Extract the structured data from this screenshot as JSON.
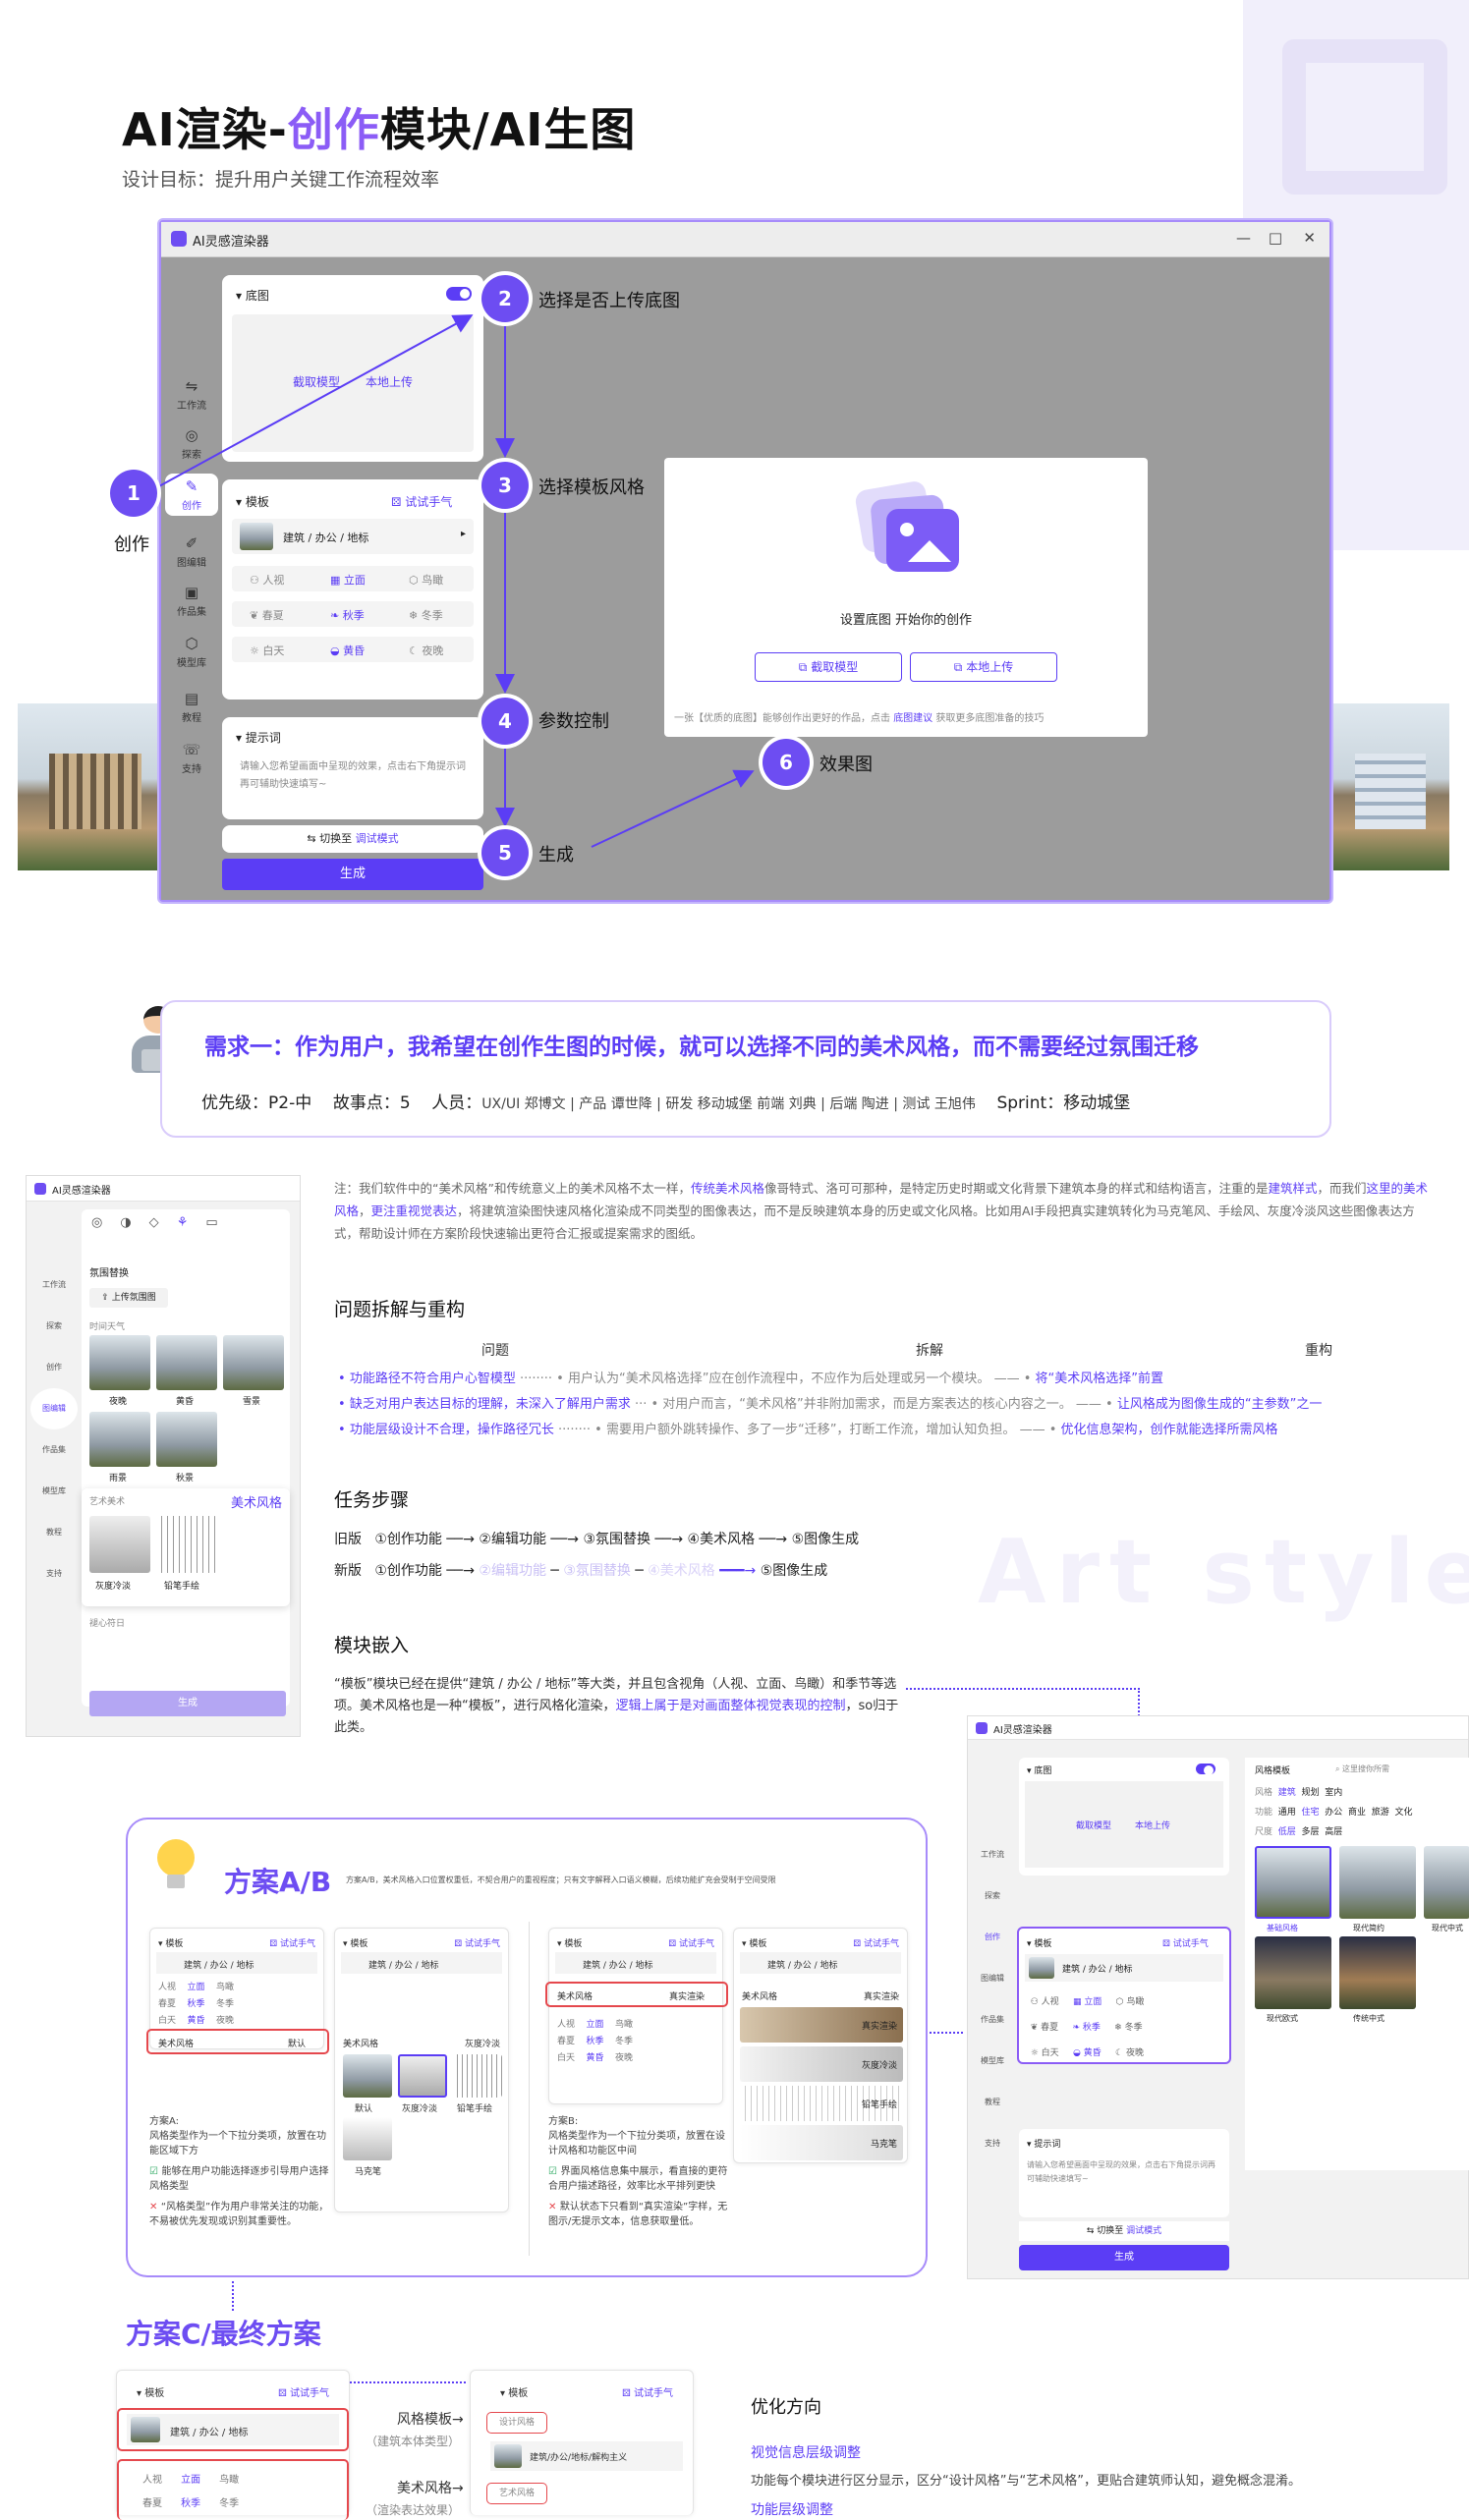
{
  "header": {
    "title_prefix": "AI渲染-",
    "title_accent": "创作",
    "title_suffix": "模块/AI生图",
    "subtitle": "设计目标：提升用户关键工作流程效率"
  },
  "app": {
    "title": "AI灵感渲染器",
    "window_controls": [
      "—",
      "□",
      "✕"
    ],
    "sidebar": [
      {
        "label": "工作流",
        "icon": "workflow-icon"
      },
      {
        "label": "探索",
        "icon": "compass-icon"
      },
      {
        "label": "创作",
        "icon": "create-icon"
      },
      {
        "label": "图编辑",
        "icon": "edit-image-icon"
      },
      {
        "label": "作品集",
        "icon": "gallery-icon"
      },
      {
        "label": "模型库",
        "icon": "model-icon"
      },
      {
        "label": "教程",
        "icon": "book-icon"
      },
      {
        "label": "支持",
        "icon": "support-icon"
      }
    ],
    "base_image": {
      "title": "底图",
      "capture_label": "截取模型",
      "upload_label": "本地上传"
    },
    "template": {
      "title": "模板",
      "try_label": "试试手气",
      "selected": "建筑 / 办公 / 地标",
      "views": [
        "人视",
        "立面",
        "鸟瞰"
      ],
      "seasons": [
        "春夏",
        "秋季",
        "冬季"
      ],
      "times": [
        "白天",
        "黄昏",
        "夜晚"
      ]
    },
    "prompt": {
      "title": "提示词",
      "placeholder": "请输入您希望画面中呈现的效果，点击右下角提示词再可辅助快速填写~"
    },
    "debug": {
      "prefix": "切换至",
      "mode": "调试模式"
    },
    "generate_label": "生成",
    "canvas": {
      "hint": "设置底图 开始你的创作",
      "capture_label": "截取模型",
      "upload_label": "本地上传",
      "footer_prefix": "一张【优质的底图】能够创作出更好的作品，点击",
      "footer_link": "底图建议",
      "footer_suffix": "获取更多底图准备的技巧"
    }
  },
  "steps": [
    {
      "n": "1",
      "label": "创作"
    },
    {
      "n": "2",
      "label": "选择是否上传底图"
    },
    {
      "n": "3",
      "label": "选择模板风格"
    },
    {
      "n": "4",
      "label": "参数控制"
    },
    {
      "n": "5",
      "label": "生成"
    },
    {
      "n": "6",
      "label": "效果图"
    }
  ],
  "requirement": {
    "title": "需求一：作为用户，我希望在创作生图的时候，就可以选择不同的美术风格，而不需要经过氛围迁移",
    "priority": "优先级：P2-中",
    "points": "故事点：5",
    "people_label": "人员：",
    "people": "UX/UI 郑博文  |  产品 谭世降  |  研发 移动城堡  前端 刘典  |  后端 陶进  |  测试 王旭伟",
    "sprint": "Sprint：移动城堡"
  },
  "note": {
    "p1": "注：我们软件中的“美术风格”和传统意义上的美术风格不太一样，",
    "h1": "传统美术风格",
    "p2": "像哥特式、洛可可那种，是特定历史时期或文化背景下建筑本身的样式和结构语言，注重的是",
    "h2": "建筑样式",
    "p3": "，而我们",
    "h3": "这里的美术风格",
    "p4": "，",
    "h4": "更注重视觉表达",
    "p5": "，将建筑渲染图快速风格化渲染成不同类型的图像表达，而不是反映建筑本身的历史或文化风格。比如用AI手段把真实建筑转化为马克笔风、手绘风、灰度冷淡风这些图像表达方式，帮助设计师在方案阶段快速输出更符合汇报或提案需求的图纸。"
  },
  "problems": {
    "heading": "问题拆解与重构",
    "cols": [
      "问题",
      "拆解",
      "重构"
    ],
    "rows": [
      [
        "功能路径不符合用户心智模型",
        "用户认为“美术风格选择”应在创作流程中，不应作为后处理或另一个模块。",
        "将“美术风格选择”前置"
      ],
      [
        "缺乏对用户表达目标的理解，未深入了解用户需求",
        "对用户而言，“美术风格”并非附加需求，而是方案表达的核心内容之一。",
        "让风格成为图像生成的“主参数”之一"
      ],
      [
        "功能层级设计不合理，操作路径冗长",
        "需要用户额外跳转操作、多了一步“迁移”，打断工作流，增加认知负担。",
        "优化信息架构，创作就能选择所需风格"
      ]
    ]
  },
  "task_steps": {
    "heading": "任务步骤",
    "old_label": "旧版",
    "new_label": "新版",
    "old": [
      "①创作功能",
      "②编辑功能",
      "③氛围替换",
      "④美术风格",
      "⑤图像生成"
    ],
    "new": [
      "①创作功能",
      "②编辑功能",
      "③氛围替换",
      "④美术风格",
      "⑤图像生成"
    ]
  },
  "embed": {
    "heading": "模块嵌入",
    "text1": "“模板”模块已经在提供“建筑 / 办公 / 地标”等大类，并且包含视角（人视、立面、鸟瞰）和季节等选项。美术风格也是一种“模板”，进行风格化渲染，",
    "text_hl": "逻辑上属于是对画面整体视觉表现的控制",
    "text2": "，so归于此类。"
  },
  "mini_app_left": {
    "title": "AI灵感渲染器",
    "section": "氛围替换",
    "upload": "上传氛围图",
    "weather": "时间天气",
    "thumbs": [
      "夜晚",
      "黄昏",
      "雪景",
      "雨景",
      "秋景"
    ],
    "art_label": "艺术美术",
    "art_title": "美术风格",
    "art_thumbs": [
      "灰度冷淡",
      "铅笔手绘"
    ],
    "more": "褪心符日",
    "generate": "生成"
  },
  "mini_app_right": {
    "title": "AI灵感渲染器",
    "template_title": "风格模板",
    "search": "这里搜你所需",
    "tabs": [
      "风格",
      "建筑",
      "规划",
      "室内"
    ],
    "func": [
      "功能",
      "通用",
      "住宅",
      "办公",
      "商业",
      "旅游",
      "文化"
    ],
    "scale": [
      "尺度",
      "低层",
      "多层",
      "高层"
    ],
    "styles": [
      "基础风格",
      "现代简约",
      "现代中式",
      "现代欧式",
      "传统中式"
    ]
  },
  "plan_ab": {
    "title": "方案A/B",
    "desc": "方案A/B，美术风格入口位置权重低，不契合用户的重视程度；只有文字解释入口语义模糊，后续功能扩充会受制于空间受限",
    "a_title": "方案A:",
    "a_desc": "风格类型作为一个下拉分类项，放置在功能区域下方",
    "a_pro": "能够在用户功能选择逐步引导用户选择风格类型",
    "a_con": "“风格类型”作为用户非常关注的功能，不易被优先发现或识别其重要性。",
    "b_title": "方案B:",
    "b_desc": "风格类型作为一个下拉分类项，放置在设计风格和功能区中间",
    "b_pro": "界面风格信息集中展示，看直接的更符合用户描述路径，效率比水平排列更快",
    "b_con": "默认状态下只看到“真实渲染”字样，无图示/无提示文本，信息获取量低。",
    "art_label": "美术风格",
    "default_label": "默认",
    "real_label": "真实渲染",
    "thumb_labels": [
      "默认",
      "灰度冷淡",
      "铅笔手绘",
      "马克笔"
    ],
    "list_labels": [
      "真实渲染",
      "灰度冷淡",
      "铅笔手绘",
      "马克笔"
    ]
  },
  "plan_c": {
    "title": "方案C/最终方案",
    "style_template": "风格模板→",
    "style_template_sub": "（建筑本体类型）",
    "art_style": "美术风格→",
    "art_style_sub": "（渲染表达效果）",
    "design_style": "设计风格",
    "art_tag": "艺术风格",
    "selected": "建筑/办公/地标/解构主义",
    "opt_title": "优化方向",
    "opt1_title": "视觉信息层级调整",
    "opt1_text": "功能每个模块进行区分显示，区分“设计风格”与“艺术风格”，更贴合建筑师认知，避免概念混淆。",
    "opt2_title": "功能层级调整"
  },
  "colors": {
    "accent": "#5b3df5",
    "accent_light": "#8b5cf6",
    "danger": "#e5484d",
    "ok": "#22a55a"
  }
}
